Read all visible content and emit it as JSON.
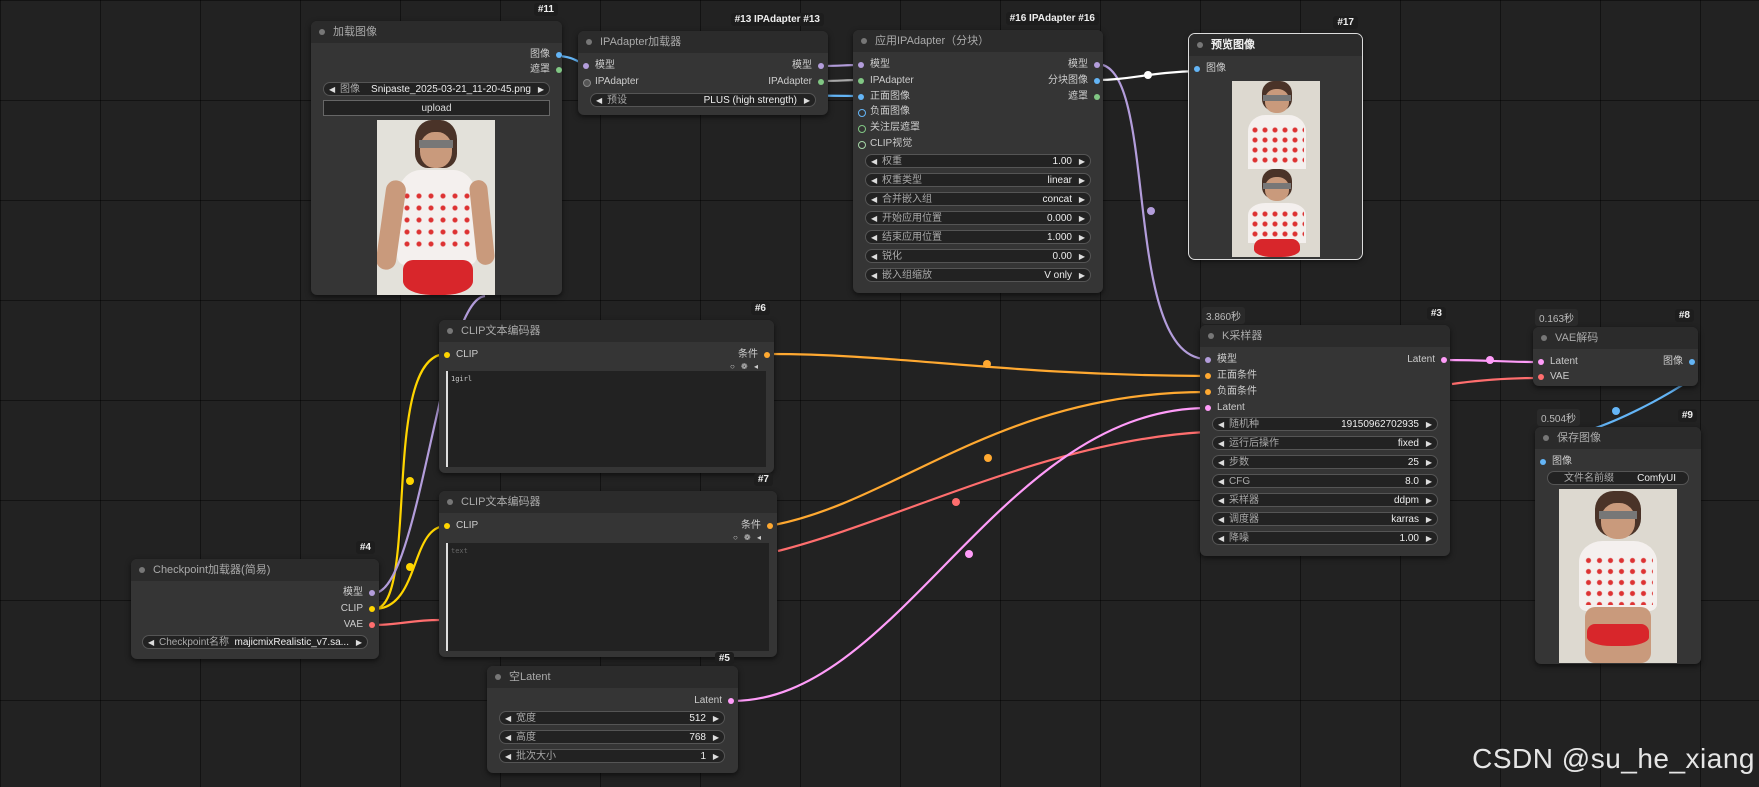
{
  "colors": {
    "model": "#b39ddb",
    "clip": "#ffd500",
    "vae": "#ff6e6e",
    "conditioning": "#ffa931",
    "latent": "#ff9cf9",
    "image": "#64b5f6",
    "mask": "#81c784",
    "ipadapter": "#aaaaaa"
  },
  "nodes": {
    "load_image": {
      "id": "#11",
      "title": "加载图像",
      "outputs": [
        "图像",
        "遮罩"
      ],
      "image_widget_label": "图像",
      "image_widget_value": "Snipaste_2025-03-21_11-20-45.png",
      "upload_label": "upload"
    },
    "ipadapter_loader": {
      "id": "#13 IPAdapter #13",
      "title": "IPAdapter加载器",
      "inputs": [
        "模型",
        "IPAdapter"
      ],
      "outputs": [
        "模型",
        "IPAdapter"
      ],
      "preset_label": "预设",
      "preset_value": "PLUS (high strength)"
    },
    "apply_ipadapter": {
      "id": "#16 IPAdapter #16",
      "title": "应用IPAdapter（分块）",
      "inputs": [
        "模型",
        "IPAdapter",
        "正面图像",
        "负面图像",
        "关注层遮罩",
        "CLIP视觉"
      ],
      "outputs": [
        "模型",
        "分块图像",
        "遮罩"
      ],
      "widgets": [
        {
          "label": "权重",
          "value": "1.00"
        },
        {
          "label": "权重类型",
          "value": "linear"
        },
        {
          "label": "合并嵌入组",
          "value": "concat"
        },
        {
          "label": "开始应用位置",
          "value": "0.000"
        },
        {
          "label": "结束应用位置",
          "value": "1.000"
        },
        {
          "label": "锐化",
          "value": "0.00"
        },
        {
          "label": "嵌入组缩放",
          "value": "V only"
        }
      ]
    },
    "preview_image": {
      "id": "#17",
      "title": "预览图像",
      "inputs": [
        "图像"
      ]
    },
    "clip_encoder_pos": {
      "id": "#6",
      "title": "CLIP文本编码器",
      "inputs": [
        "CLIP"
      ],
      "outputs": [
        "条件"
      ],
      "text": "1girl"
    },
    "clip_encoder_neg": {
      "id": "#7",
      "title": "CLIP文本编码器",
      "inputs": [
        "CLIP"
      ],
      "outputs": [
        "条件"
      ],
      "text": "text"
    },
    "checkpoint_loader": {
      "id": "#4",
      "title": "Checkpoint加载器(简易)",
      "outputs": [
        "模型",
        "CLIP",
        "VAE"
      ],
      "ckpt_label": "Checkpoint名称",
      "ckpt_value": "majicmixRealistic_v7.sa..."
    },
    "empty_latent": {
      "id": "#5",
      "title": "空Latent",
      "outputs": [
        "Latent"
      ],
      "widgets": [
        {
          "label": "宽度",
          "value": "512"
        },
        {
          "label": "高度",
          "value": "768"
        },
        {
          "label": "批次大小",
          "value": "1"
        }
      ]
    },
    "ksampler": {
      "id": "#3",
      "title": "K采样器",
      "exec_time": "3.860秒",
      "inputs": [
        "模型",
        "正面条件",
        "负面条件",
        "Latent"
      ],
      "outputs": [
        "Latent"
      ],
      "widgets": [
        {
          "label": "随机种",
          "value": "191509627029​35"
        },
        {
          "label": "运行后操作",
          "value": "fixed"
        },
        {
          "label": "步数",
          "value": "25"
        },
        {
          "label": "CFG",
          "value": "8.0"
        },
        {
          "label": "采样器",
          "value": "ddpm"
        },
        {
          "label": "调度器",
          "value": "karras"
        },
        {
          "label": "降噪",
          "value": "1.00"
        }
      ]
    },
    "vae_decode": {
      "id": "#8",
      "title": "VAE解码",
      "exec_time": "0.163秒",
      "inputs": [
        "Latent",
        "VAE"
      ],
      "outputs": [
        "图像"
      ]
    },
    "save_image": {
      "id": "#9",
      "title": "保存图像",
      "exec_time": "0.504秒",
      "inputs": [
        "图像"
      ],
      "prefix_label": "文件名前缀",
      "prefix_value": "ComfyUI"
    }
  },
  "watermark": "CSDN @su_he_xiang"
}
